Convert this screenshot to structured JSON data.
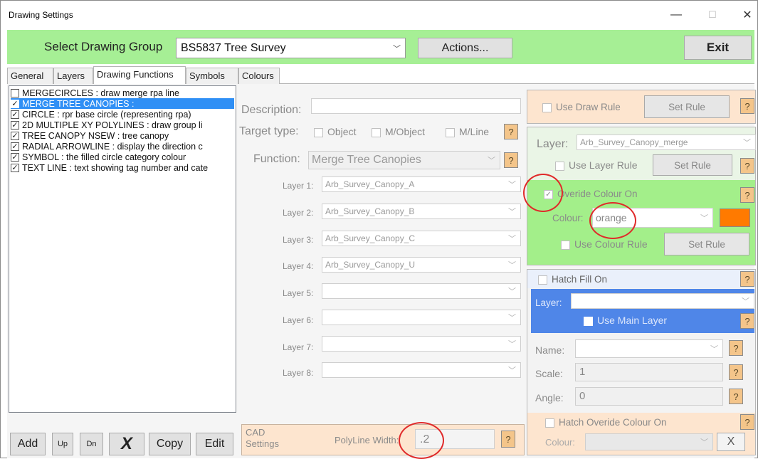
{
  "window": {
    "title": "Drawing Settings",
    "minimize": "—",
    "maximize": "☐",
    "close": "✕"
  },
  "toolbar": {
    "select_label": "Select Drawing Group",
    "group_value": "BS5837 Tree Survey",
    "actions_label": "Actions...",
    "exit_label": "Exit"
  },
  "tabs": [
    "General",
    "Layers",
    "Drawing Functions",
    "Symbols",
    "Colours"
  ],
  "functions": [
    {
      "checked": false,
      "text": "MERGECIRCLES : draw merge rpa line",
      "selected": false
    },
    {
      "checked": true,
      "text": "MERGE TREE CANOPIES :",
      "selected": true
    },
    {
      "checked": true,
      "text": "CIRCLE : rpr base circle (representing rpa)",
      "selected": false
    },
    {
      "checked": true,
      "text": "2D MULTIPLE XY POLYLINES : draw group li",
      "selected": false
    },
    {
      "checked": true,
      "text": "TREE CANOPY NSEW : tree canopy",
      "selected": false
    },
    {
      "checked": true,
      "text": "RADIAL ARROWLINE : display the direction c",
      "selected": false
    },
    {
      "checked": true,
      "text": "SYMBOL : the filled circle category colour",
      "selected": false
    },
    {
      "checked": true,
      "text": "TEXT LINE : text showing tag number and cate",
      "selected": false
    }
  ],
  "list_buttons": {
    "add": "Add",
    "up": "Up",
    "dn": "Dn",
    "delete": "X",
    "copy": "Copy",
    "edit": "Edit"
  },
  "details": {
    "description_label": "Description:",
    "description_value": "",
    "target_label": "Target type:",
    "target_object": "Object",
    "target_mobject": "M/Object",
    "target_mline": "M/Line",
    "function_label": "Function:",
    "function_value": "Merge Tree Canopies",
    "layers": [
      {
        "label": "Layer 1:",
        "value": "Arb_Survey_Canopy_A"
      },
      {
        "label": "Layer 2:",
        "value": "Arb_Survey_Canopy_B"
      },
      {
        "label": "Layer 3:",
        "value": "Arb_Survey_Canopy_C"
      },
      {
        "label": "Layer 4:",
        "value": "Arb_Survey_Canopy_U"
      },
      {
        "label": "Layer 5:",
        "value": ""
      },
      {
        "label": "Layer 6:",
        "value": ""
      },
      {
        "label": "Layer 7:",
        "value": ""
      },
      {
        "label": "Layer 8:",
        "value": ""
      }
    ],
    "help": "?"
  },
  "cad": {
    "label": "CAD Settings",
    "polyline_label": "PolyLine Width:",
    "polyline_value": ".2"
  },
  "draw_rule": {
    "label": "Use Draw Rule",
    "set_rule": "Set Rule"
  },
  "layer_panel": {
    "layer_label": "Layer:",
    "layer_value": "Arb_Survey_Canopy_merge",
    "use_layer_rule": "Use Layer Rule",
    "set_rule": "Set Rule",
    "override_label": "Overide Colour On",
    "override_checked": true,
    "colour_label": "Colour:",
    "colour_value": "orange",
    "colour_swatch": "#ff7a00",
    "use_colour_rule": "Use Colour Rule",
    "set_rule2": "Set Rule"
  },
  "hatch": {
    "fill_label": "Hatch Fill On",
    "layer_label": "Layer:",
    "use_main_layer": "Use Main Layer",
    "name_label": "Name:",
    "scale_label": "Scale:",
    "scale_value": "1",
    "angle_label": "Angle:",
    "angle_value": "0",
    "override_label": "Hatch Overide Colour On",
    "colour_label": "Colour:",
    "x_label": "X"
  },
  "colors": {
    "toolbar": "#a6ef95",
    "help": "#f4c58a",
    "selection": "#2f8ff5",
    "hatch_blue": "#4f86e8",
    "layer_green": "#a3ef8a"
  }
}
